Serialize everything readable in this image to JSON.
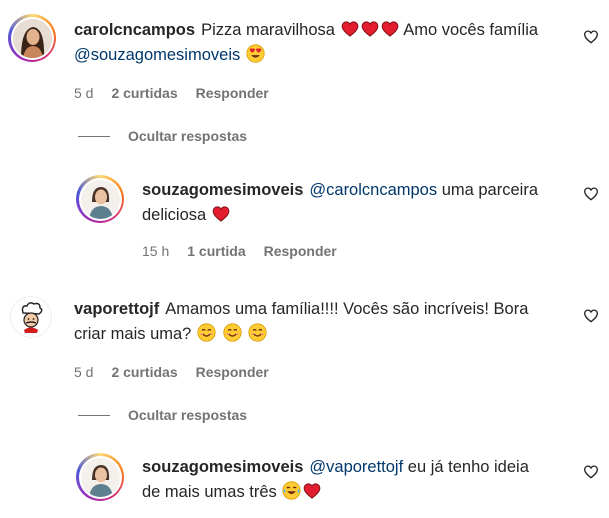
{
  "comments": [
    {
      "username": "carolcncampos",
      "text": "Pizza maravilhosa",
      "text2": "Amo vocês família",
      "mention": "@souzagomesimoveis",
      "time": "5 d",
      "likes": "2 curtidas",
      "reply": "Responder",
      "hide_replies": "Ocultar respostas",
      "reply_comment": {
        "username": "souzagomesimoveis",
        "mention": "@carolcncampos",
        "text": "uma parceira",
        "text2": "deliciosa",
        "time": "15 h",
        "likes": "1 curtida",
        "reply": "Responder"
      }
    },
    {
      "username": "vaporettojf",
      "text": "Amamos uma família!!!! Vocês são incríveis! Bora",
      "text2": "criar mais uma?",
      "time": "5 d",
      "likes": "2 curtidas",
      "reply": "Responder",
      "hide_replies": "Ocultar respostas",
      "reply_comment": {
        "username": "souzagomesimoveis",
        "mention": "@vaporettojf",
        "text": "eu já tenho ideia",
        "text2": "de mais umas três"
      }
    }
  ],
  "colors": {
    "heart": "#e0245e",
    "mention": "#00376b",
    "muted": "#737373"
  },
  "icons": [
    "heart-outline-icon",
    "red-heart-emoji",
    "heart-eyes-emoji",
    "smiling-face-emoji",
    "tears-of-joy-emoji"
  ]
}
